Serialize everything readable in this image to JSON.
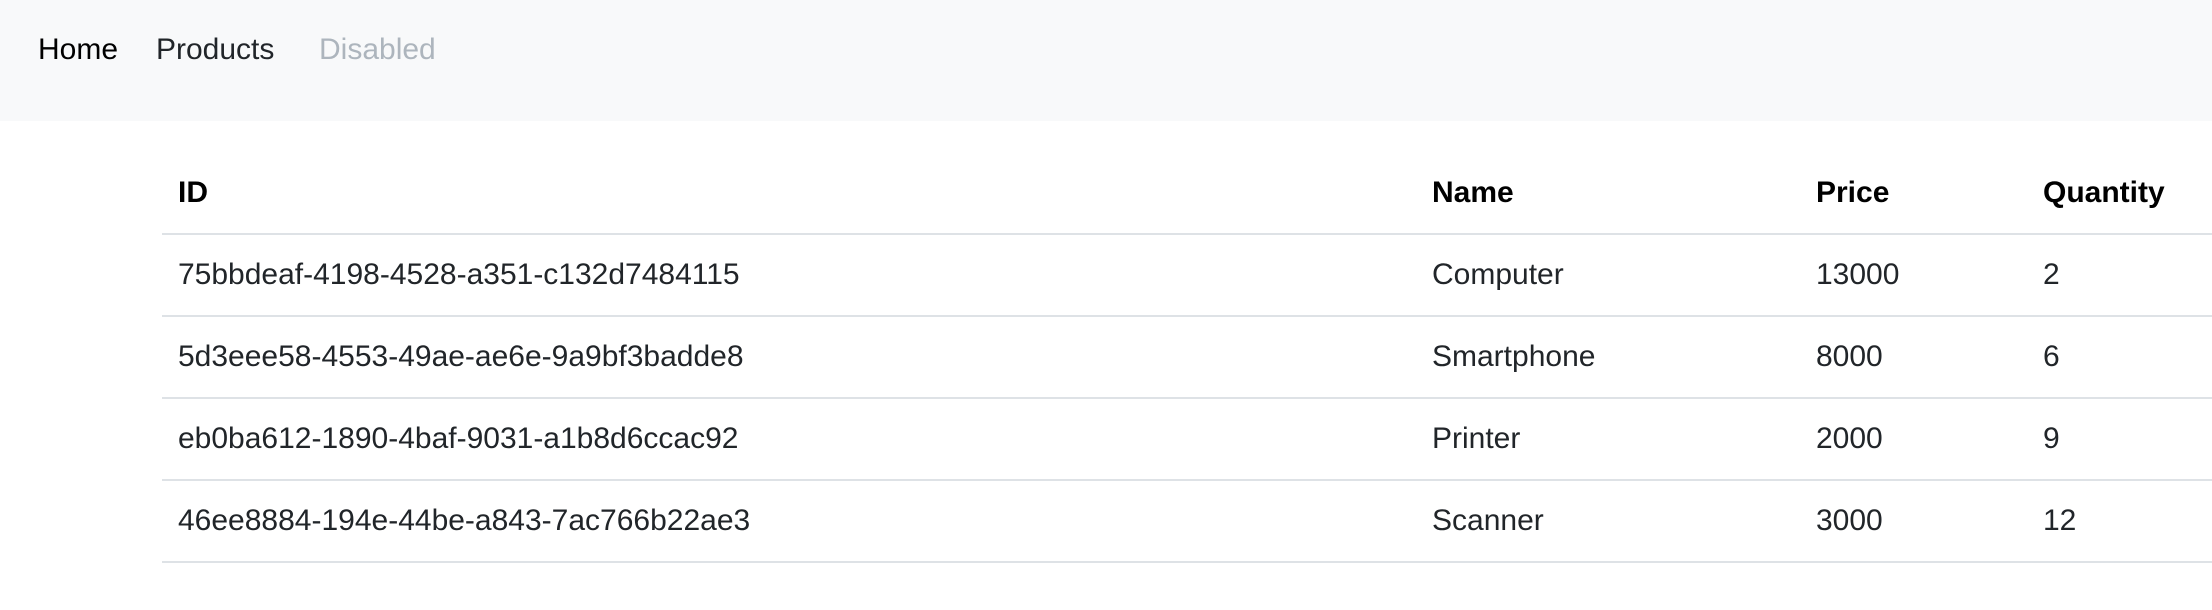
{
  "nav": {
    "home": "Home",
    "products": "Products",
    "disabled": "Disabled"
  },
  "table": {
    "headers": {
      "id": "ID",
      "name": "Name",
      "price": "Price",
      "quantity": "Quantity"
    },
    "rows": [
      {
        "id": "75bbdeaf-4198-4528-a351-c132d7484115",
        "name": "Computer",
        "price": "13000",
        "quantity": "2"
      },
      {
        "id": "5d3eee58-4553-49ae-ae6e-9a9bf3badde8",
        "name": "Smartphone",
        "price": "8000",
        "quantity": "6"
      },
      {
        "id": "eb0ba612-1890-4baf-9031-a1b8d6ccac92",
        "name": "Printer",
        "price": "2000",
        "quantity": "9"
      },
      {
        "id": "46ee8884-194e-44be-a843-7ac766b22ae3",
        "name": "Scanner",
        "price": "3000",
        "quantity": "12"
      }
    ]
  }
}
